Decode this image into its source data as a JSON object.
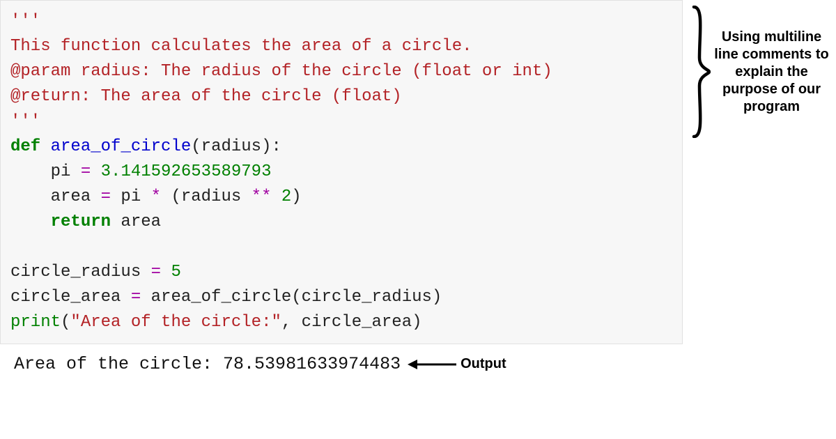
{
  "code": {
    "doc_open": "'''",
    "doc_line1": "This function calculates the area of a circle.",
    "doc_line2": "@param radius: The radius of the circle (float or int)",
    "doc_line3": "@return: The area of the circle (float)",
    "doc_close": "'''",
    "def_kw": "def",
    "func_name": "area_of_circle",
    "paren_open": "(",
    "param": "radius",
    "paren_close_colon": "):",
    "pi_assign_pre": "    pi ",
    "eq1": "=",
    "pi_val": " 3.141592653589793",
    "area_assign_pre": "    area ",
    "eq2": "=",
    "area_mid1": " pi ",
    "star": "*",
    "area_mid2": " (radius ",
    "pow": "**",
    "space3": " ",
    "two": "2",
    "close_paren": ")",
    "return_indent": "    ",
    "return_kw": "return",
    "return_rest": " area",
    "blank": "",
    "cr_assign_pre": "circle_radius ",
    "eq3": "=",
    "space5": " ",
    "five": "5",
    "ca_assign_pre": "circle_area ",
    "eq4": "=",
    "ca_rest": " area_of_circle(circle_radius)",
    "print_name": "print",
    "print_open": "(",
    "print_str": "\"Area of the circle:\"",
    "print_rest": ", circle_area)"
  },
  "output": {
    "text": "Area of the circle: 78.53981633974483",
    "label": "Output"
  },
  "annotation": {
    "right": "Using multiline line comments to explain the purpose of our program"
  },
  "colors": {
    "docstring": "#b32226",
    "keyword": "#008000",
    "funcname": "#0000cc",
    "operator": "#a000a0"
  }
}
